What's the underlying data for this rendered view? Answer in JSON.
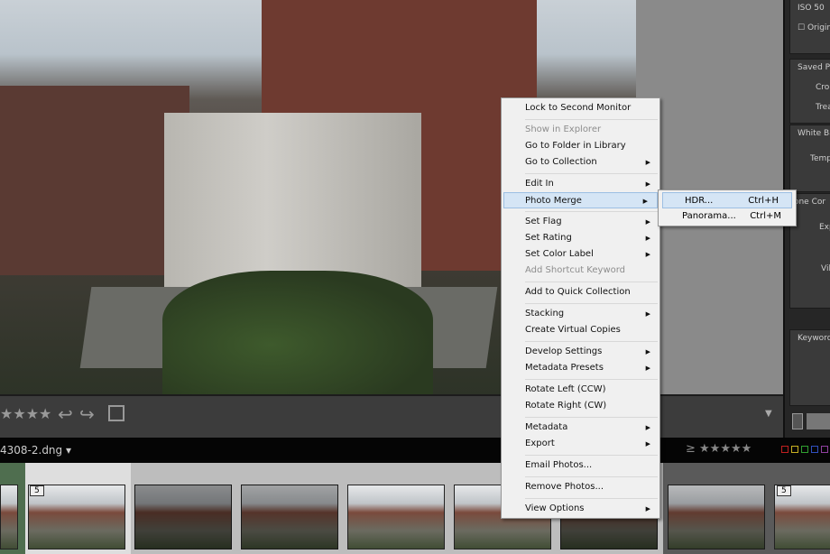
{
  "right_panel": {
    "iso": "ISO 50",
    "original": "Original",
    "saved_presets": "Saved Pr",
    "crop": "Crop",
    "treat": "Trea",
    "white_balance": "White Ba",
    "temp": "Tempe",
    "tone_control": "Tone Cor",
    "exposure": "Exp",
    "vibrance": "Vil",
    "keyword": "Keyword"
  },
  "toolbar": {
    "rating_stars": "★★★★",
    "rotate_left": "↩",
    "rotate_right": "↪"
  },
  "namebar": {
    "filename": "4308-2.dng",
    "filter_stars": "≥ ★★★★★",
    "label_colors": [
      "#c02020",
      "#c8b020",
      "#30a030",
      "#3050c0",
      "#9040a0"
    ]
  },
  "filmstrip": {
    "stack_count": "5",
    "stack_count_2": "5"
  },
  "context_menu": {
    "items": [
      {
        "label": "Lock to Second Monitor"
      },
      {
        "sep": true
      },
      {
        "label": "Show in Explorer",
        "disabled": true
      },
      {
        "label": "Go to Folder in Library"
      },
      {
        "label": "Go to Collection",
        "sub": true
      },
      {
        "sep": true
      },
      {
        "label": "Edit In",
        "sub": true
      },
      {
        "label": "Photo Merge",
        "sub": true,
        "highlighted": true
      },
      {
        "sep": true
      },
      {
        "label": "Set Flag",
        "sub": true
      },
      {
        "label": "Set Rating",
        "sub": true
      },
      {
        "label": "Set Color Label",
        "sub": true
      },
      {
        "label": "Add Shortcut Keyword",
        "disabled": true
      },
      {
        "sep": true
      },
      {
        "label": "Add to Quick Collection"
      },
      {
        "sep": true
      },
      {
        "label": "Stacking",
        "sub": true
      },
      {
        "label": "Create Virtual Copies"
      },
      {
        "sep": true
      },
      {
        "label": "Develop Settings",
        "sub": true
      },
      {
        "label": "Metadata Presets",
        "sub": true
      },
      {
        "sep": true
      },
      {
        "label": "Rotate Left (CCW)"
      },
      {
        "label": "Rotate Right (CW)"
      },
      {
        "sep": true
      },
      {
        "label": "Metadata",
        "sub": true
      },
      {
        "label": "Export",
        "sub": true
      },
      {
        "sep": true
      },
      {
        "label": "Email Photos..."
      },
      {
        "sep": true
      },
      {
        "label": "Remove Photos..."
      },
      {
        "sep": true
      },
      {
        "label": "View Options",
        "sub": true
      }
    ]
  },
  "submenu": {
    "items": [
      {
        "label": "HDR...",
        "shortcut": "Ctrl+H",
        "highlighted": true
      },
      {
        "label": "Panorama...",
        "shortcut": "Ctrl+M"
      }
    ]
  }
}
